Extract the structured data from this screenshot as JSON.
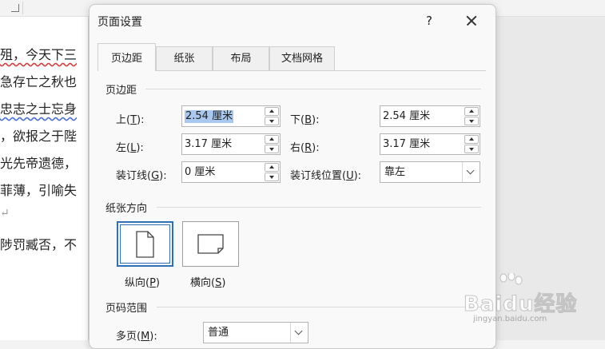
{
  "background_doc": {
    "lines": [
      "殂，今天下三",
      "急存亡之秋也",
      "忠志之士忘身",
      "，欲报之于陛",
      "光先帝遗德，",
      "菲薄，引喻失",
      "",
      "陟罚臧否，不"
    ],
    "paragraph_mark": "↵"
  },
  "dialog": {
    "title": "页面设置",
    "help_label": "?",
    "tabs": [
      {
        "label": "页边距"
      },
      {
        "label": "纸张"
      },
      {
        "label": "布局"
      },
      {
        "label": "文档网格"
      }
    ],
    "margins": {
      "section_title": "页边距",
      "top": {
        "label": "上(",
        "key": "T",
        "tail": "):",
        "value": "2.54 厘米"
      },
      "bottom": {
        "label": "下(",
        "key": "B",
        "tail": "):",
        "value": "2.54 厘米"
      },
      "left": {
        "label": "左(",
        "key": "L",
        "tail": "):",
        "value": "3.17 厘米"
      },
      "right": {
        "label": "右(",
        "key": "R",
        "tail": "):",
        "value": "3.17 厘米"
      },
      "gutter": {
        "label": "装订线(",
        "key": "G",
        "tail": "):",
        "value": "0 厘米"
      },
      "gutter_pos": {
        "label": "装订线位置(",
        "key": "U",
        "tail": "):",
        "value": "靠左"
      }
    },
    "orientation": {
      "section_title": "纸张方向",
      "portrait": {
        "label": "纵向(",
        "key": "P",
        "tail": ")"
      },
      "landscape": {
        "label": "横向(",
        "key": "S",
        "tail": ")"
      },
      "selected": "portrait"
    },
    "pages": {
      "section_title": "页码范围",
      "multiple": {
        "label": "多页(",
        "key": "M",
        "tail": "):",
        "value": "普通"
      }
    }
  },
  "watermark": {
    "text": "Baidu经验",
    "sub": "jingyan.baidu.com"
  },
  "colors": {
    "selection": "#a8c8ef",
    "accent": "#2f6fb3"
  }
}
